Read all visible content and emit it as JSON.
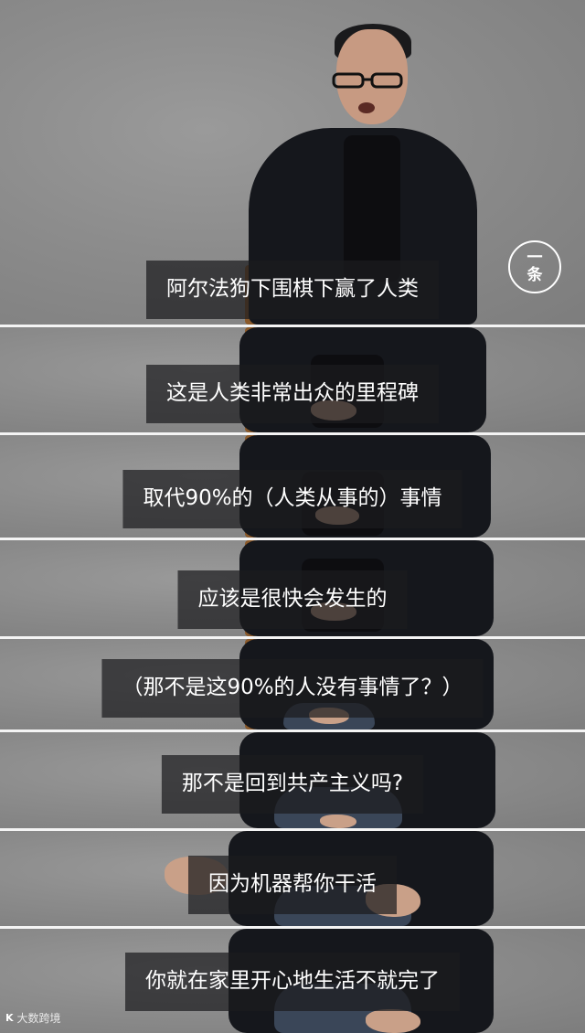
{
  "badge": {
    "line1": "一",
    "line2": "条"
  },
  "captions": [
    "阿尔法狗下围棋下赢了人类",
    "这是人类非常出众的里程碑",
    "取代90%的（人类从事的）事情",
    "应该是很快会发生的",
    "（那不是这90%的人没有事情了？）",
    "那不是回到共产主义吗?",
    "因为机器帮你干活",
    "你就在家里开心地生活不就完了"
  ],
  "watermark": {
    "logo": "K",
    "text": "大数跨境"
  }
}
